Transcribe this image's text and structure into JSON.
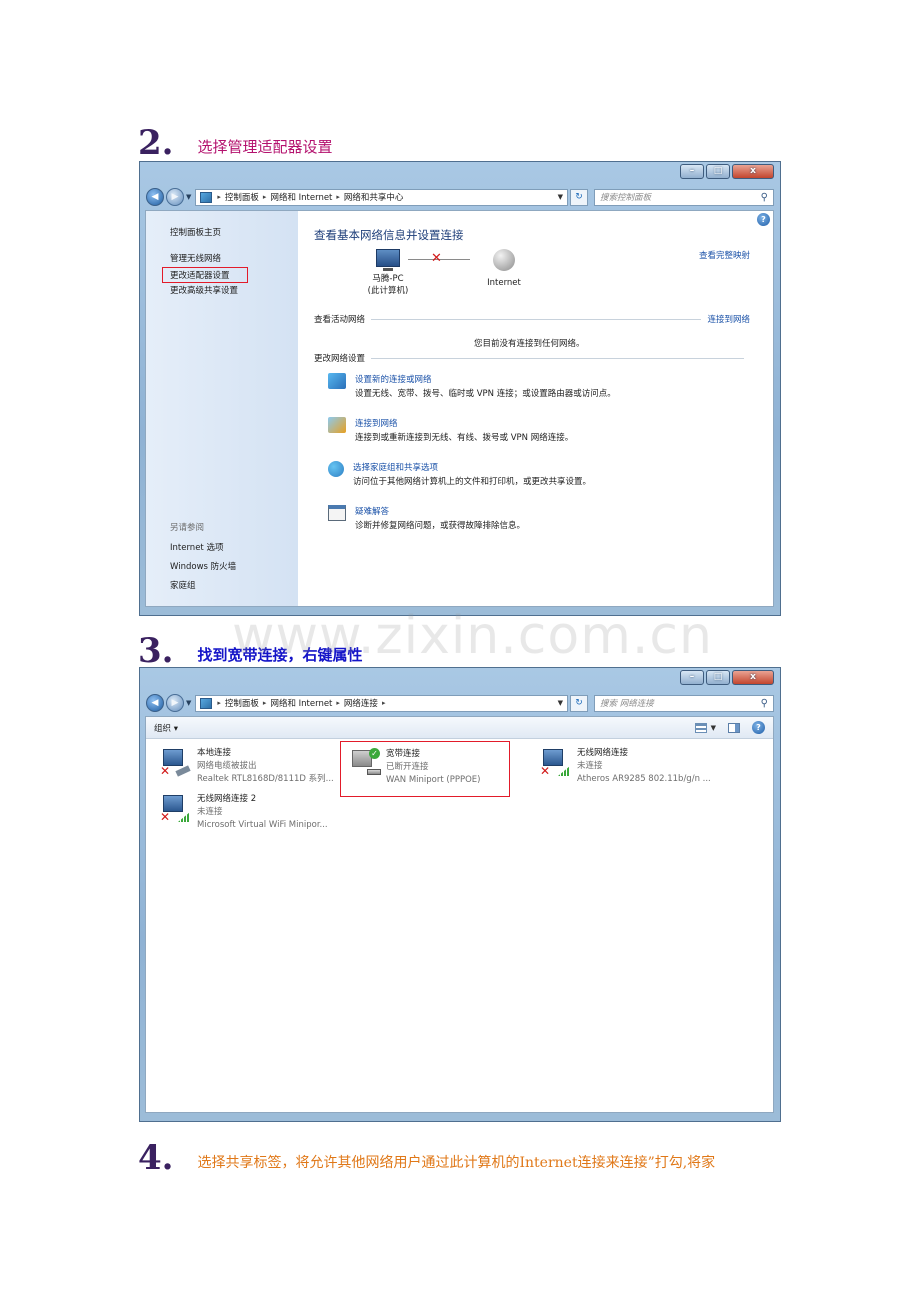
{
  "step2": {
    "number": "2.",
    "text": "选择管理适配器设置"
  },
  "step3": {
    "number": "3.",
    "text": "找到宽带连接，右键属性"
  },
  "step4": {
    "number": "4.",
    "text": "选择共享标签，将允许其他网络用户通过此计算机的Internet连接来连接”打勾,将家"
  },
  "watermark": "www.zixin.com.cn",
  "window_controls": {
    "minimize": "–",
    "maximize": "□",
    "close": "x"
  },
  "win1": {
    "breadcrumbs": [
      "控制面板",
      "网络和 Internet",
      "网络和共享中心"
    ],
    "search_placeholder": "搜索控制面板",
    "sidebar": {
      "home": "控制面板主页",
      "links": [
        "管理无线网络",
        "更改适配器设置",
        "更改高级共享设置"
      ],
      "see_also_label": "另请参阅",
      "see_also": [
        "Internet 选项",
        "Windows 防火墙",
        "家庭组"
      ]
    },
    "title": "查看基本网络信息并设置连接",
    "view_full_map": "查看完整映射",
    "computer_name": "马腾-PC",
    "computer_sub": "(此计算机)",
    "internet_label": "Internet",
    "active_network_label": "查看活动网络",
    "connect_link": "连接到网络",
    "no_network": "您目前没有连接到任何网络。",
    "change_settings_label": "更改网络设置",
    "tasks": [
      {
        "title": "设置新的连接或网络",
        "desc": "设置无线、宽带、拨号、临时或 VPN 连接；或设置路由器或访问点。",
        "icon": "network-setup-icon"
      },
      {
        "title": "连接到网络",
        "desc": "连接到或重新连接到无线、有线、拨号或 VPN 网络连接。",
        "icon": "connect-network-icon"
      },
      {
        "title": "选择家庭组和共享选项",
        "desc": "访问位于其他网络计算机上的文件和打印机，或更改共享设置。",
        "icon": "homegroup-icon"
      },
      {
        "title": "疑难解答",
        "desc": "诊断并修复网络问题，或获得故障排除信息。",
        "icon": "troubleshoot-icon"
      }
    ]
  },
  "win2": {
    "breadcrumbs": [
      "控制面板",
      "网络和 Internet",
      "网络连接"
    ],
    "search_placeholder": "搜索 网络连接",
    "organize": "组织 ▾",
    "connections": [
      {
        "name": "本地连接",
        "status": "网络电缆被拔出",
        "device": "Realtek RTL8168D/8111D 系列..."
      },
      {
        "name": "宽带连接",
        "status": "已断开连接",
        "device": "WAN Miniport (PPPOE)"
      },
      {
        "name": "无线网络连接",
        "status": "未连接",
        "device": "Atheros AR9285 802.11b/g/n ..."
      },
      {
        "name": "无线网络连接 2",
        "status": "未连接",
        "device": "Microsoft Virtual WiFi Minipor..."
      }
    ]
  },
  "colors": {
    "highlight_box": "#e21b2a",
    "link": "#1b52a8",
    "title": "#1f3f7a"
  }
}
